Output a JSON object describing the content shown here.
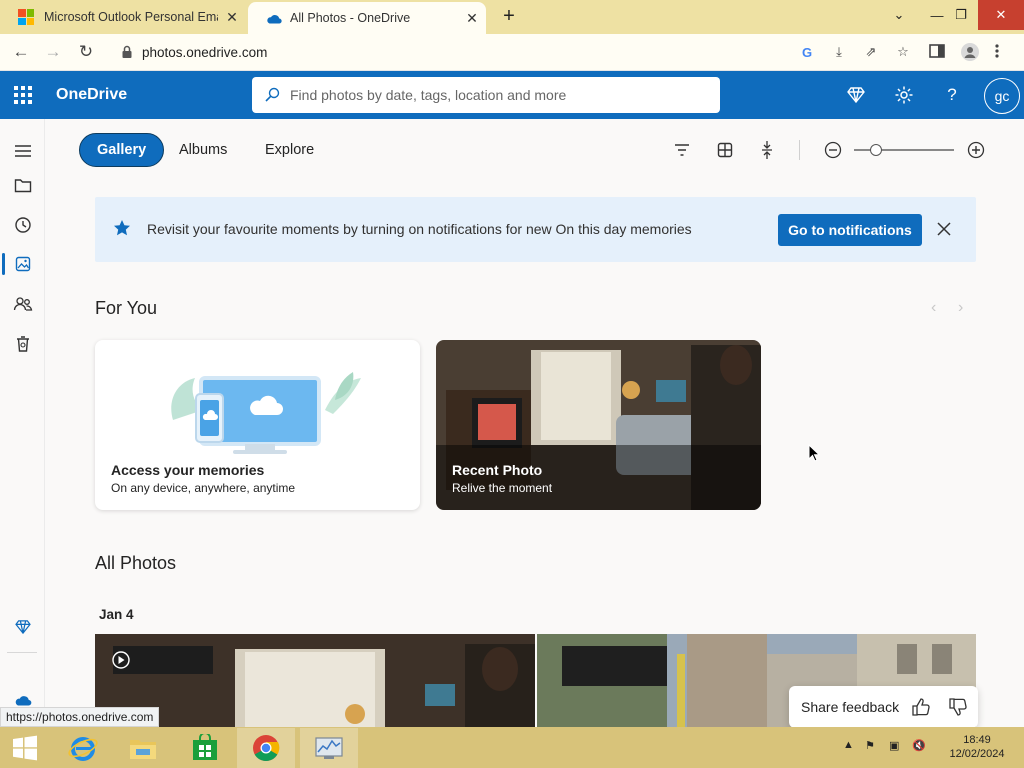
{
  "browser": {
    "tabs": [
      {
        "title": "Microsoft Outlook Personal Email",
        "active": false
      },
      {
        "title": "All Photos - OneDrive",
        "active": true
      }
    ],
    "new_tab": "+",
    "url": "photos.onedrive.com",
    "status_url": "https://photos.onedrive.com"
  },
  "app": {
    "brand": "OneDrive",
    "search_placeholder": "Find photos by date, tags, location and more",
    "avatar_initials": "gc",
    "accent": "#0f6cbd"
  },
  "pivots": [
    {
      "label": "Gallery",
      "selected": true
    },
    {
      "label": "Albums",
      "selected": false
    },
    {
      "label": "Explore",
      "selected": false
    }
  ],
  "zoom_slider": {
    "level": 0.18
  },
  "banner": {
    "message": "Revisit your favourite moments by turning on notifications for new On this day memories",
    "action_label": "Go to notifications"
  },
  "for_you": {
    "heading": "For You",
    "cards": [
      {
        "title": "Access your memories",
        "subtitle": "On any device, anywhere, anytime"
      },
      {
        "title": "Recent Photo",
        "subtitle": "Relive the moment"
      }
    ]
  },
  "all_photos": {
    "heading": "All Photos",
    "groups": [
      {
        "date": "Jan 4",
        "count": 2
      }
    ]
  },
  "feedback": {
    "label": "Share feedback"
  },
  "taskbar": {
    "time": "18:49",
    "date": "12/02/2024"
  }
}
